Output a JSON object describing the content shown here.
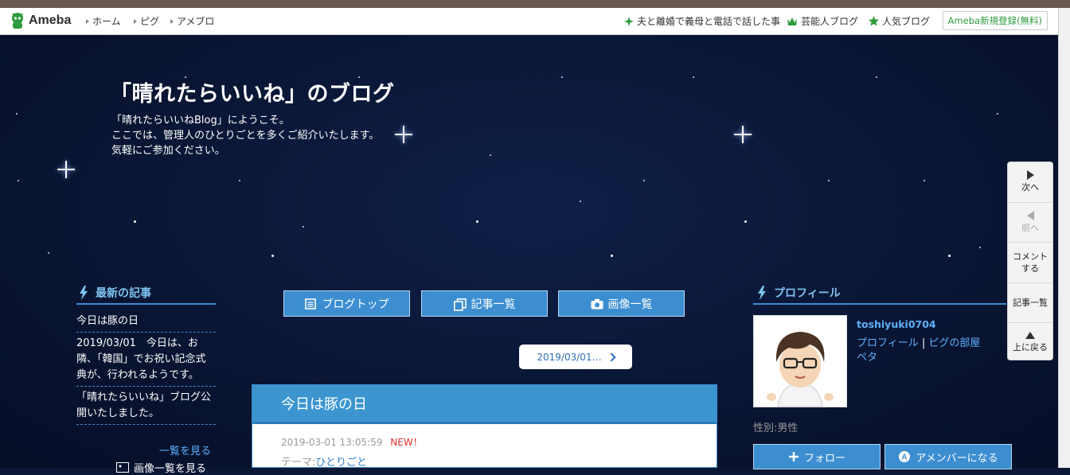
{
  "header": {
    "logo_text": "Ameba",
    "nav": [
      "ホーム",
      "ピグ",
      "アメブロ"
    ],
    "right_links": [
      "夫と離婚で義母と電話で話した事",
      "芸能人ブログ",
      "人気ブログ"
    ],
    "register_label": "Ameba新規登録(無料)"
  },
  "blog": {
    "title": "「晴れたらいいね」のブログ",
    "description": [
      "「晴れたらいいねBlog」にようこそ。",
      "ここでは、管理人のひとりごとを多くご紹介いたします。",
      "気軽にご参加ください。"
    ]
  },
  "latest": {
    "heading": "最新の記事",
    "items": [
      "今日は豚の日",
      "2019/03/01　今日は、お隣、「韓国」でお祝い記念式典が、行われるようです。",
      "「晴れたらいいね」ブログ公開いたしました。"
    ],
    "see_all": "一覧を見る",
    "image_list": "画像一覧を見る"
  },
  "center_nav": [
    "ブログトップ",
    "記事一覧",
    "画像一覧"
  ],
  "date_pill": "2019/03/01…",
  "article": {
    "title": "今日は豚の日",
    "datetime": "2019-03-01 13:05:59",
    "new_badge": "NEW！",
    "theme_label": "テーマ:",
    "theme": "ひとりごと"
  },
  "profile": {
    "heading": "プロフィール",
    "name": "toshiyuki0704",
    "link_profile": "プロフィール",
    "separator": "|",
    "link_room": "ピグの部屋",
    "link_peta": "ペタ",
    "gender": "性別:男性",
    "follow": "フォロー",
    "amember": "アメンバーになる"
  },
  "pager": {
    "next": "次へ",
    "prev": "前へ",
    "comment": [
      "コメント",
      "する"
    ],
    "list": "記事一覧",
    "top": "上に戻る"
  },
  "colors": {
    "accent": "#3c8ed0",
    "link": "#5fb0ff",
    "new": "#e23030",
    "green": "#2d9b3d"
  }
}
